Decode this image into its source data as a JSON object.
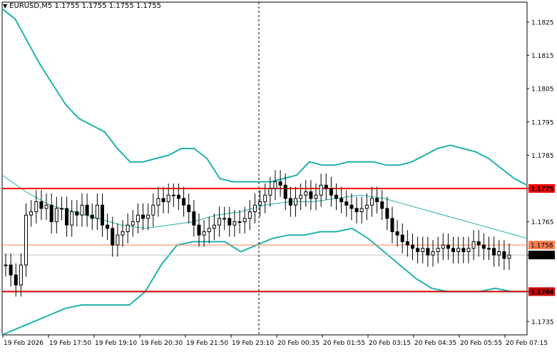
{
  "symbol_header": {
    "dropdown_icon": "triangle-down-icon",
    "text": "EURUSD,M5  1.1755 1.1755 1.1755 1.1755"
  },
  "chart_data": {
    "type": "candlestick",
    "symbol": "EURUSD",
    "timeframe": "M5",
    "ohlc_header": [
      1.1755,
      1.1755,
      1.1755,
      1.1755
    ],
    "ylim": [
      1.1731,
      1.1831
    ],
    "y_ticks": [
      "1.1825",
      "1.1815",
      "1.1805",
      "1.1795",
      "1.1785",
      "1.1775",
      "1.1765",
      "1.1755",
      "1.1744",
      "1.1735"
    ],
    "x_ticks": [
      "19 Feb 2026",
      "19 Feb 17:50",
      "19 Feb 19:10",
      "19 Feb 20:30",
      "19 Feb 21:50",
      "19 Feb 23:10",
      "20 Feb 00:35",
      "20 Feb 01:55",
      "20 Feb 03:15",
      "20 Feb 04:35",
      "20 Feb 05:55",
      "20 Feb 07:15"
    ],
    "horizontal_lines": [
      {
        "price": 1.1775,
        "label": "1.1775",
        "color": "#ff0000",
        "style": "thick"
      },
      {
        "price": 1.1758,
        "label": "1.1758",
        "color": "#ff7f50",
        "style": "thin"
      },
      {
        "price": 1.1744,
        "label": "1.1744",
        "color": "#cc0000",
        "style": "thick"
      }
    ],
    "current_price": {
      "price": 1.1755,
      "label": "1.1755"
    },
    "period_separator_label": "19 Feb 23:10",
    "close_series": [
      1.1752,
      1.1749,
      1.1746,
      1.1752,
      1.1767,
      1.1768,
      1.1771,
      1.1769,
      1.177,
      1.1765,
      1.1769,
      1.1769,
      1.1764,
      1.1768,
      1.1767,
      1.177,
      1.1767,
      1.1766,
      1.177,
      1.1764,
      1.1763,
      1.1758,
      1.1761,
      1.1762,
      1.1764,
      1.1765,
      1.1767,
      1.1766,
      1.1767,
      1.177,
      1.1772,
      1.1771,
      1.1773,
      1.1773,
      1.1772,
      1.177,
      1.1768,
      1.1764,
      1.1761,
      1.1762,
      1.1763,
      1.1764,
      1.1766,
      1.1766,
      1.1764,
      1.1765,
      1.1765,
      1.1766,
      1.1768,
      1.177,
      1.1771,
      1.1773,
      1.1775,
      1.1777,
      1.1776,
      1.1772,
      1.177,
      1.1772,
      1.1773,
      1.1774,
      1.1772,
      1.1773,
      1.1776,
      1.1775,
      1.1773,
      1.1772,
      1.1771,
      1.177,
      1.1769,
      1.1768,
      1.1769,
      1.177,
      1.1772,
      1.1771,
      1.1769,
      1.1766,
      1.1762,
      1.1761,
      1.1759,
      1.1758,
      1.1757,
      1.1756,
      1.1757,
      1.1755,
      1.1756,
      1.1757,
      1.1758,
      1.1757,
      1.1756,
      1.1757,
      1.1756,
      1.1757,
      1.1759,
      1.1758,
      1.1757,
      1.1757,
      1.1755,
      1.1756,
      1.1754,
      1.1755
    ],
    "bollinger_upper": [
      1.1829,
      1.1826,
      1.1819,
      1.1812,
      1.1806,
      1.18,
      1.1796,
      1.1794,
      1.1792,
      1.1787,
      1.1783,
      1.1783,
      1.1784,
      1.1785,
      1.1787,
      1.1787,
      1.1784,
      1.1778,
      1.1777,
      1.1777,
      1.1777,
      1.1777,
      1.1778,
      1.1779,
      1.1783,
      1.1782,
      1.1782,
      1.1783,
      1.1783,
      1.1783,
      1.1782,
      1.1782,
      1.1783,
      1.1785,
      1.1787,
      1.1788,
      1.1787,
      1.1786,
      1.1784,
      1.1781,
      1.1778,
      1.1776
    ],
    "bollinger_mid": [
      1.1779,
      1.1774,
      1.177,
      1.1768,
      1.1766,
      1.1764,
      1.1763,
      1.1764,
      1.1765,
      1.1767,
      1.1768,
      1.177,
      1.1771,
      1.1771,
      1.1772,
      1.1773,
      1.1772,
      1.177,
      1.1768,
      1.1766,
      1.1764,
      1.1762,
      1.176
    ],
    "bollinger_lower": [
      1.1731,
      1.1733,
      1.1735,
      1.1737,
      1.1739,
      1.174,
      1.174,
      1.174,
      1.174,
      1.1744,
      1.1752,
      1.1758,
      1.1759,
      1.1759,
      1.1759,
      1.1756,
      1.1758,
      1.176,
      1.1761,
      1.1761,
      1.1762,
      1.1762,
      1.1763,
      1.176,
      1.1756,
      1.1752,
      1.1748,
      1.1745,
      1.1744,
      1.1744,
      1.1744,
      1.1745,
      1.1744,
      1.1744
    ]
  }
}
